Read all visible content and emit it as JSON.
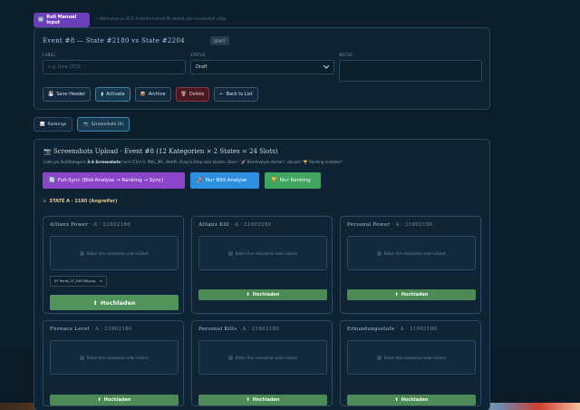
{
  "top": {
    "pill_icon": "🔤",
    "pill_label": "Roll Manual Input",
    "hint": "← Alternative zu OCR: Einzelnd Format fill ablade, kein Screenshot nötig"
  },
  "event": {
    "title": "Event #8 — State #2180 vs State #2204",
    "status_badge": "DRAFT",
    "label_caption": "LABEL",
    "label_placeholder": "e.g. June 2025",
    "status_caption": "STATUS",
    "status_value": "Draft",
    "notes_caption": "NOTES",
    "buttons": {
      "save": "Save Header",
      "activate": "Activate",
      "archive": "Archive",
      "delete": "Delete",
      "back": "Back to List"
    },
    "icons": {
      "save": "💾",
      "activate": "▮",
      "archive": "📦",
      "delete": "🗑",
      "back": "←"
    }
  },
  "tabs": [
    {
      "icon": "📊",
      "label": "Rankings"
    },
    {
      "icon": "📷",
      "label": "Screenshots (0)"
    }
  ],
  "upload": {
    "title_icon": "📷",
    "title": "Screenshots Upload · Event #8 (12 Kategorien × 2 States = 24 Slots)",
    "desc_pre": "Lade pro Slot/Kategorie ",
    "desc_bold": "3–6 Screenshots",
    "desc_post": " hoch (Ctrl+V, PNG, JPG, WebP). Drag & Drop oder klicken. Dann: \"🚀 Bild-Analyse starten\", danach \"🏆 Ranking erstellen\".",
    "actions": {
      "full_sync": "Full-Sync (Bild-Analyse → Ranking → Sync)",
      "analysis_only": "Nur Bild-Analyse",
      "ranking_only": "Nur Ranking"
    },
    "action_icons": {
      "full_sync": "🔄",
      "analysis_only": "🚀",
      "ranking_only": "🏆"
    },
    "state_icon": "⚔",
    "state_label": "STATE A · 2180 (Angreifer)",
    "drop_text": "Bilder hier reinziehen oder klicken",
    "upload_label": "Hochladen",
    "upload_icon": "⬆",
    "cards": [
      {
        "title": "Allianz Power",
        "sub": " · A · 21802180",
        "file": "IFI Terrile_07_045796.png"
      },
      {
        "title": "Allianz Kill",
        "sub": " · A · 21802180"
      },
      {
        "title": "Personal Power",
        "sub": " · A · 21802180"
      },
      {
        "title": "Furnace Level",
        "sub": " · A · 21802180"
      },
      {
        "title": "Personal Kills",
        "sub": " · A · 21802180"
      },
      {
        "title": "Erkundungsstufe",
        "sub": " · A · 21802180"
      }
    ]
  },
  "colors": {
    "accent_purple": "#8a45c9",
    "accent_blue": "#2d8fe0",
    "accent_green": "#3fa560",
    "upload_green": "#4d8a56"
  }
}
